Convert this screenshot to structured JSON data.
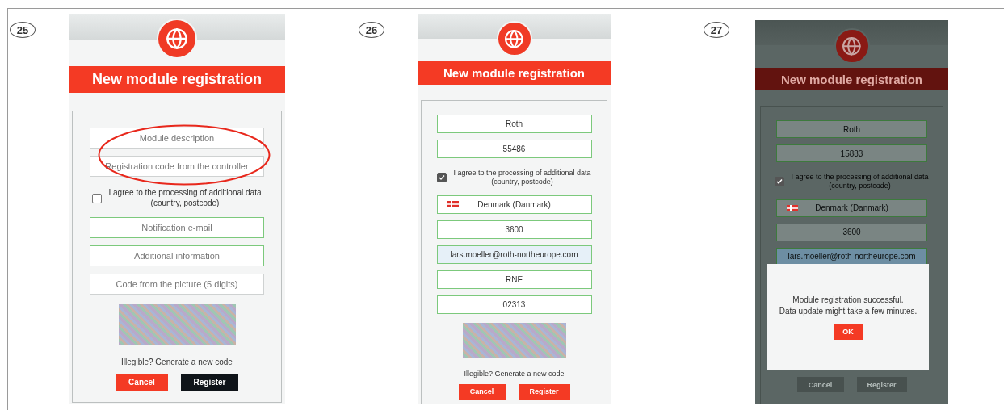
{
  "figures": [
    {
      "number": "25",
      "title": "New module registration",
      "dimmed": false,
      "annotation_ellipse": true,
      "items": [
        {
          "kind": "field",
          "placeholder": "Module description",
          "valid": false,
          "autofilled": false
        },
        {
          "kind": "field",
          "placeholder": "Registration code from the controller",
          "valid": false,
          "autofilled": false
        },
        {
          "kind": "consent",
          "text_lines": [
            "I agree to the processing of additional data",
            "(country, postcode)"
          ],
          "checked": false
        },
        {
          "kind": "field",
          "placeholder": "Notification e-mail",
          "valid": true,
          "autofilled": false
        },
        {
          "kind": "field",
          "placeholder": "Additional information",
          "valid": true,
          "autofilled": false
        },
        {
          "kind": "field",
          "placeholder": "Code from the picture (5 digits)",
          "valid": false,
          "autofilled": false
        },
        {
          "kind": "captcha"
        },
        {
          "kind": "link",
          "text": "Illegible? Generate a new code"
        }
      ],
      "buttons": [
        {
          "label": "Cancel",
          "hovered": false,
          "disabled": false
        },
        {
          "label": "Register",
          "hovered": true,
          "disabled": false
        }
      ]
    },
    {
      "number": "26",
      "title": "New module registration",
      "dimmed": false,
      "annotation_ellipse": false,
      "items": [
        {
          "kind": "field",
          "value": "Roth",
          "valid": true,
          "autofilled": false
        },
        {
          "kind": "field",
          "value": "55486",
          "valid": true,
          "autofilled": false
        },
        {
          "kind": "consent",
          "text_lines": [
            "I agree to the processing of additional data",
            "(country, postcode)"
          ],
          "checked": true
        },
        {
          "kind": "country",
          "value": "Denmark (Danmark)",
          "valid": true,
          "autofilled": false
        },
        {
          "kind": "field",
          "value": "3600",
          "valid": true,
          "autofilled": false
        },
        {
          "kind": "field",
          "value": "lars.moeller@roth-northeurope.com",
          "valid": true,
          "autofilled": true
        },
        {
          "kind": "field",
          "value": "RNE",
          "valid": true,
          "autofilled": false
        },
        {
          "kind": "field",
          "value": "02313",
          "valid": true,
          "autofilled": false
        },
        {
          "kind": "captcha"
        },
        {
          "kind": "link",
          "text": "Illegible? Generate a new code"
        }
      ],
      "buttons": [
        {
          "label": "Cancel",
          "hovered": false,
          "disabled": false
        },
        {
          "label": "Register",
          "hovered": false,
          "disabled": false
        }
      ]
    },
    {
      "number": "27",
      "title": "New module registration",
      "dimmed": true,
      "annotation_ellipse": false,
      "items": [
        {
          "kind": "field",
          "value": "Roth",
          "valid": true,
          "autofilled": false
        },
        {
          "kind": "field",
          "value": "15883",
          "valid": true,
          "autofilled": false
        },
        {
          "kind": "consent",
          "text_lines": [
            "I agree to the processing of additional data",
            "(country, postcode)"
          ],
          "checked": true
        },
        {
          "kind": "country",
          "value": "Denmark (Danmark)",
          "valid": true,
          "autofilled": false
        },
        {
          "kind": "field",
          "value": "3600",
          "valid": true,
          "autofilled": false
        },
        {
          "kind": "field",
          "value": "lars.moeller@roth-northeurope.com",
          "valid": true,
          "autofilled": true
        }
      ],
      "dialog": {
        "message_lines": [
          "Module registration successful.",
          "Data update might take a few minutes."
        ],
        "button": "OK"
      },
      "buttons": [
        {
          "label": "Cancel",
          "hovered": false,
          "disabled": true
        },
        {
          "label": "Register",
          "hovered": false,
          "disabled": true
        }
      ]
    }
  ]
}
